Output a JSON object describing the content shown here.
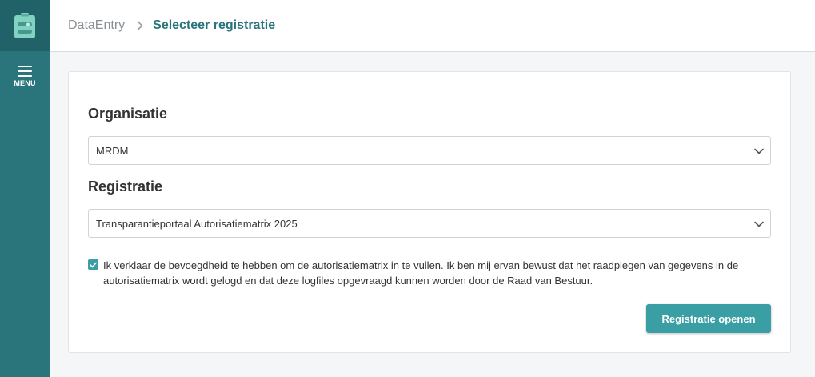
{
  "app": {
    "logo_icon": "clipboard-app-icon",
    "brand_color": "#2a747c",
    "accent_color": "#3a9ea5"
  },
  "sidebar": {
    "menu_label": "MENU",
    "menu_icon": "hamburger-icon"
  },
  "breadcrumb": {
    "root": "DataEntry",
    "separator_icon": "chevron-right-icon",
    "current": "Selecteer registratie"
  },
  "form": {
    "organisation": {
      "label": "Organisatie",
      "value": "MRDM"
    },
    "registration": {
      "label": "Registratie",
      "value": "Transparantieportaal Autorisatiematrix 2025"
    },
    "consent": {
      "checked": true,
      "text": "Ik verklaar de bevoegdheid te hebben om de autorisatiematrix in te vullen. Ik ben mij ervan bewust dat het raadplegen van gegevens in de autorisatiematrix wordt gelogd en dat deze logfiles opgevraagd kunnen worden door de Raad van Bestuur."
    },
    "submit_label": "Registratie openen"
  }
}
